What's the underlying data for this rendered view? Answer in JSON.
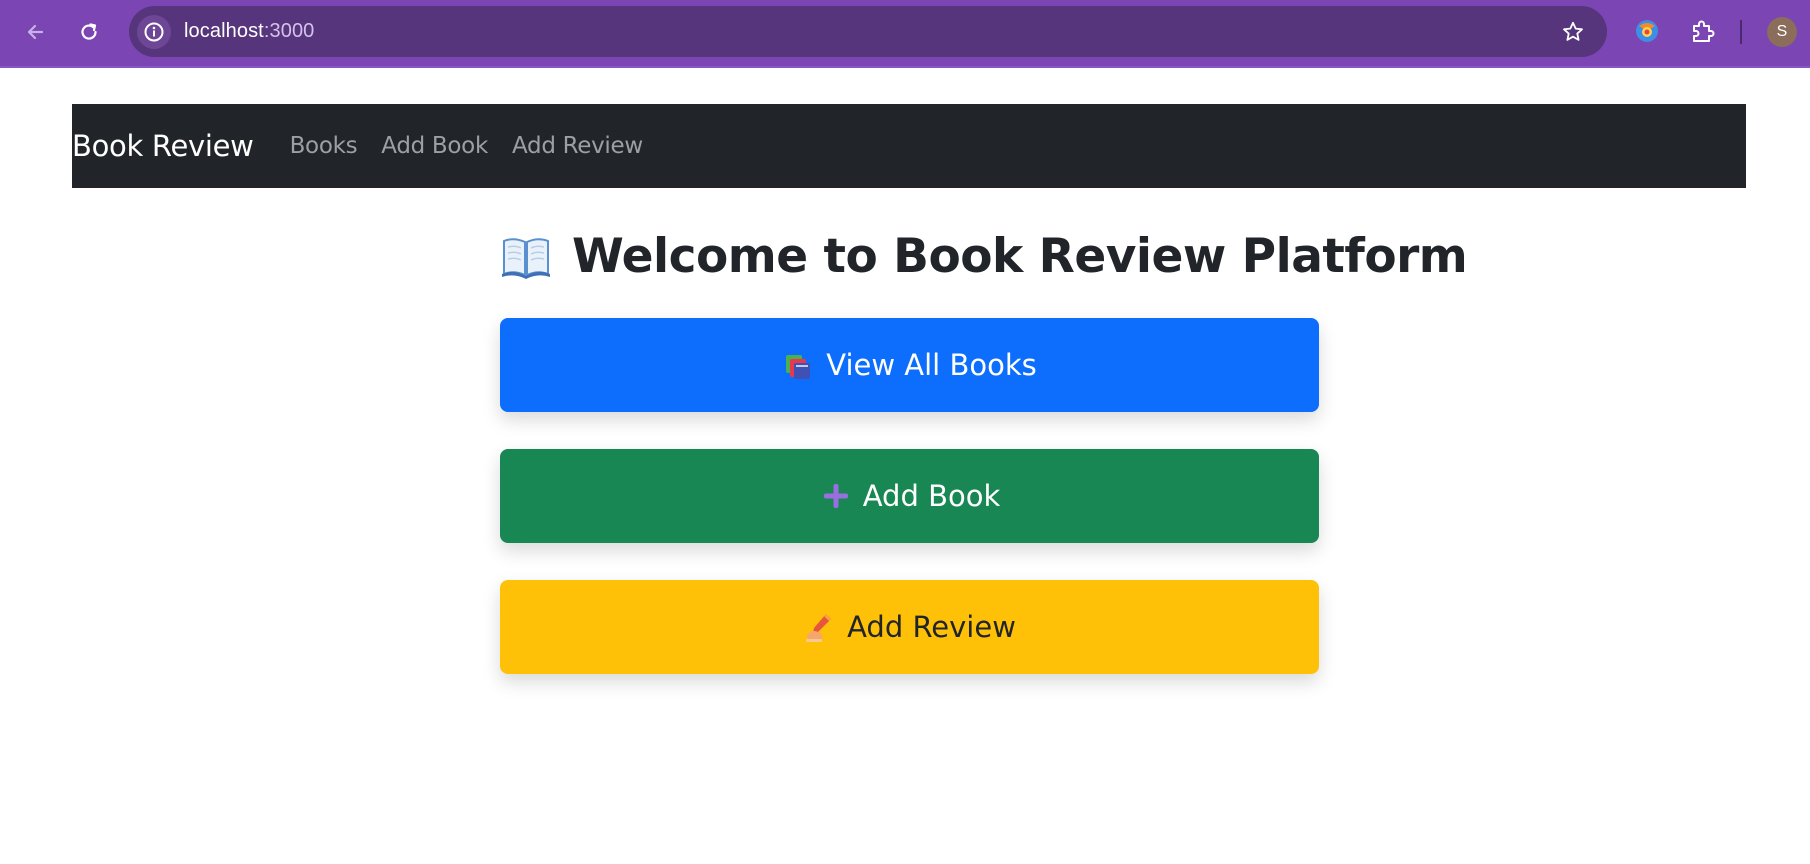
{
  "browser": {
    "url_host": "localhost",
    "url_port": ":3000",
    "profile_initial": "S",
    "colors": {
      "frame": "#7b45b4",
      "omnibox": "#56357c"
    },
    "icons": [
      "back-arrow-icon",
      "reload-icon",
      "site-info-icon",
      "bookmark-star-icon",
      "extension-icon",
      "puzzle-extensions-icon"
    ]
  },
  "navbar": {
    "brand": "Book Review",
    "links": [
      {
        "label": "Books"
      },
      {
        "label": "Add Book"
      },
      {
        "label": "Add Review"
      }
    ],
    "colors": {
      "background": "#212529",
      "brand": "#ffffff",
      "link": "#9aa0a6"
    }
  },
  "main": {
    "title": "Welcome to Book Review Platform",
    "title_icon": "open-book-icon",
    "buttons": [
      {
        "label": "View All Books",
        "icon": "books-icon",
        "color": "#0d6efd"
      },
      {
        "label": "Add Book",
        "icon": "plus-icon",
        "color": "#198754"
      },
      {
        "label": "Add Review",
        "icon": "writing-hand-icon",
        "color": "#ffc107"
      }
    ]
  }
}
